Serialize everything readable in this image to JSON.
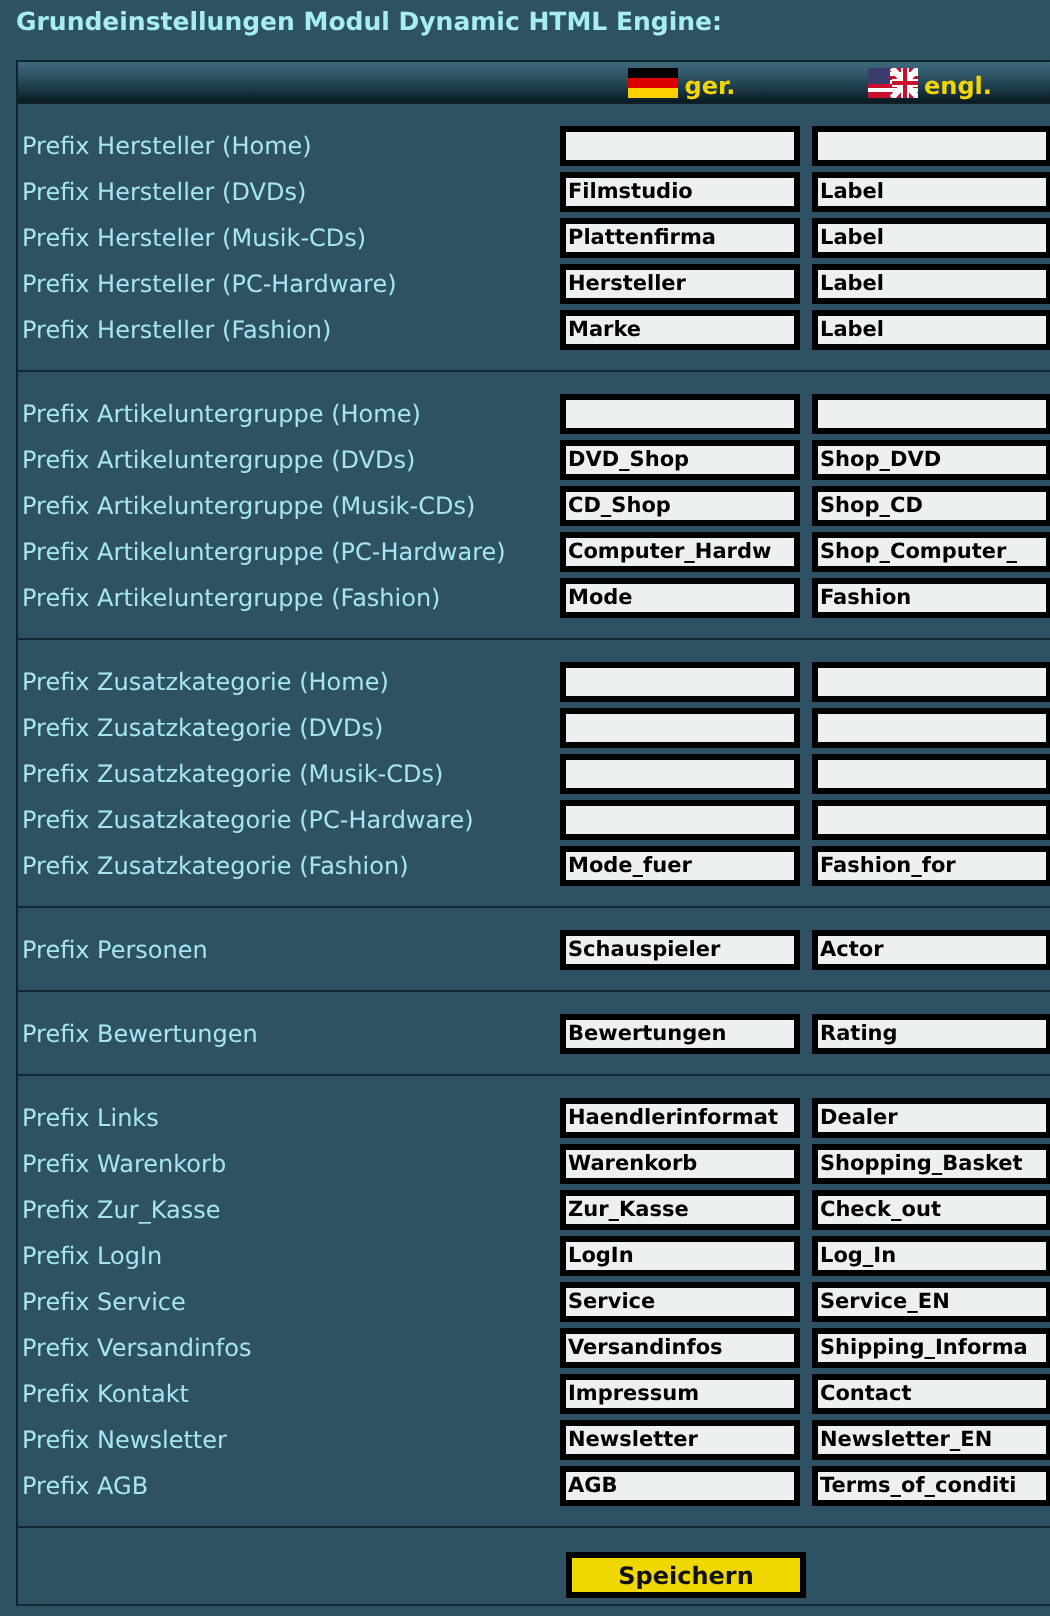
{
  "title": "Grundeinstellungen Modul Dynamic HTML Engine:",
  "columns": [
    {
      "label": "ger.",
      "kind": "german"
    },
    {
      "label": "engl.",
      "kind": "english"
    }
  ],
  "groups": [
    {
      "rows": [
        {
          "label": "Prefix Hersteller (Home)"
        },
        {
          "label": "Prefix Hersteller (DVDs)",
          "ger": "Filmstudio",
          "engl": "Label"
        },
        {
          "label": "Prefix Hersteller (Musik-CDs)",
          "ger": "Plattenfirma",
          "engl": "Label"
        },
        {
          "label": "Prefix Hersteller (PC-Hardware)",
          "ger": "Hersteller",
          "engl": "Label"
        },
        {
          "label": "Prefix Hersteller (Fashion)",
          "ger": "Marke",
          "engl": "Label"
        }
      ]
    },
    {
      "rows": [
        {
          "label": "Prefix Artikeluntergruppe (Home)"
        },
        {
          "label": "Prefix Artikeluntergruppe (DVDs)",
          "ger": "DVD_Shop",
          "engl": "Shop_DVD"
        },
        {
          "label": "Prefix Artikeluntergruppe (Musik-CDs)",
          "ger": "CD_Shop",
          "engl": "Shop_CD"
        },
        {
          "label": "Prefix Artikeluntergruppe (PC-Hardware)",
          "ger": "Computer_Hardw",
          "engl": "Shop_Computer_"
        },
        {
          "label": "Prefix Artikeluntergruppe (Fashion)",
          "ger": "Mode",
          "engl": "Fashion"
        }
      ]
    },
    {
      "rows": [
        {
          "label": "Prefix Zusatzkategorie (Home)"
        },
        {
          "label": "Prefix Zusatzkategorie (DVDs)"
        },
        {
          "label": "Prefix Zusatzkategorie (Musik-CDs)"
        },
        {
          "label": "Prefix Zusatzkategorie (PC-Hardware)"
        },
        {
          "label": "Prefix Zusatzkategorie (Fashion)",
          "ger": "Mode_fuer",
          "engl": "Fashion_for"
        }
      ]
    },
    {
      "rows": [
        {
          "label": "Prefix Personen",
          "ger": "Schauspieler",
          "engl": "Actor"
        }
      ]
    },
    {
      "rows": [
        {
          "label": "Prefix Bewertungen",
          "ger": "Bewertungen",
          "engl": "Rating"
        }
      ]
    },
    {
      "rows": [
        {
          "label": "Prefix Links",
          "ger": "Haendlerinformat",
          "engl": "Dealer"
        },
        {
          "label": "Prefix Warenkorb",
          "ger": "Warenkorb",
          "engl": "Shopping_Basket"
        },
        {
          "label": "Prefix Zur_Kasse",
          "ger": "Zur_Kasse",
          "engl": "Check_out"
        },
        {
          "label": "Prefix LogIn",
          "ger": "LogIn",
          "engl": "Log_In"
        },
        {
          "label": "Prefix Service",
          "ger": "Service",
          "engl": "Service_EN"
        },
        {
          "label": "Prefix Versandinfos",
          "ger": "Versandinfos",
          "engl": "Shipping_Informa"
        },
        {
          "label": "Prefix Kontakt",
          "ger": "Impressum",
          "engl": "Contact"
        },
        {
          "label": "Prefix Newsletter",
          "ger": "Newsletter",
          "engl": "Newsletter_EN"
        },
        {
          "label": "Prefix AGB",
          "ger": "AGB",
          "engl": "Terms_of_conditi"
        }
      ]
    }
  ],
  "save_button": "Speichern"
}
